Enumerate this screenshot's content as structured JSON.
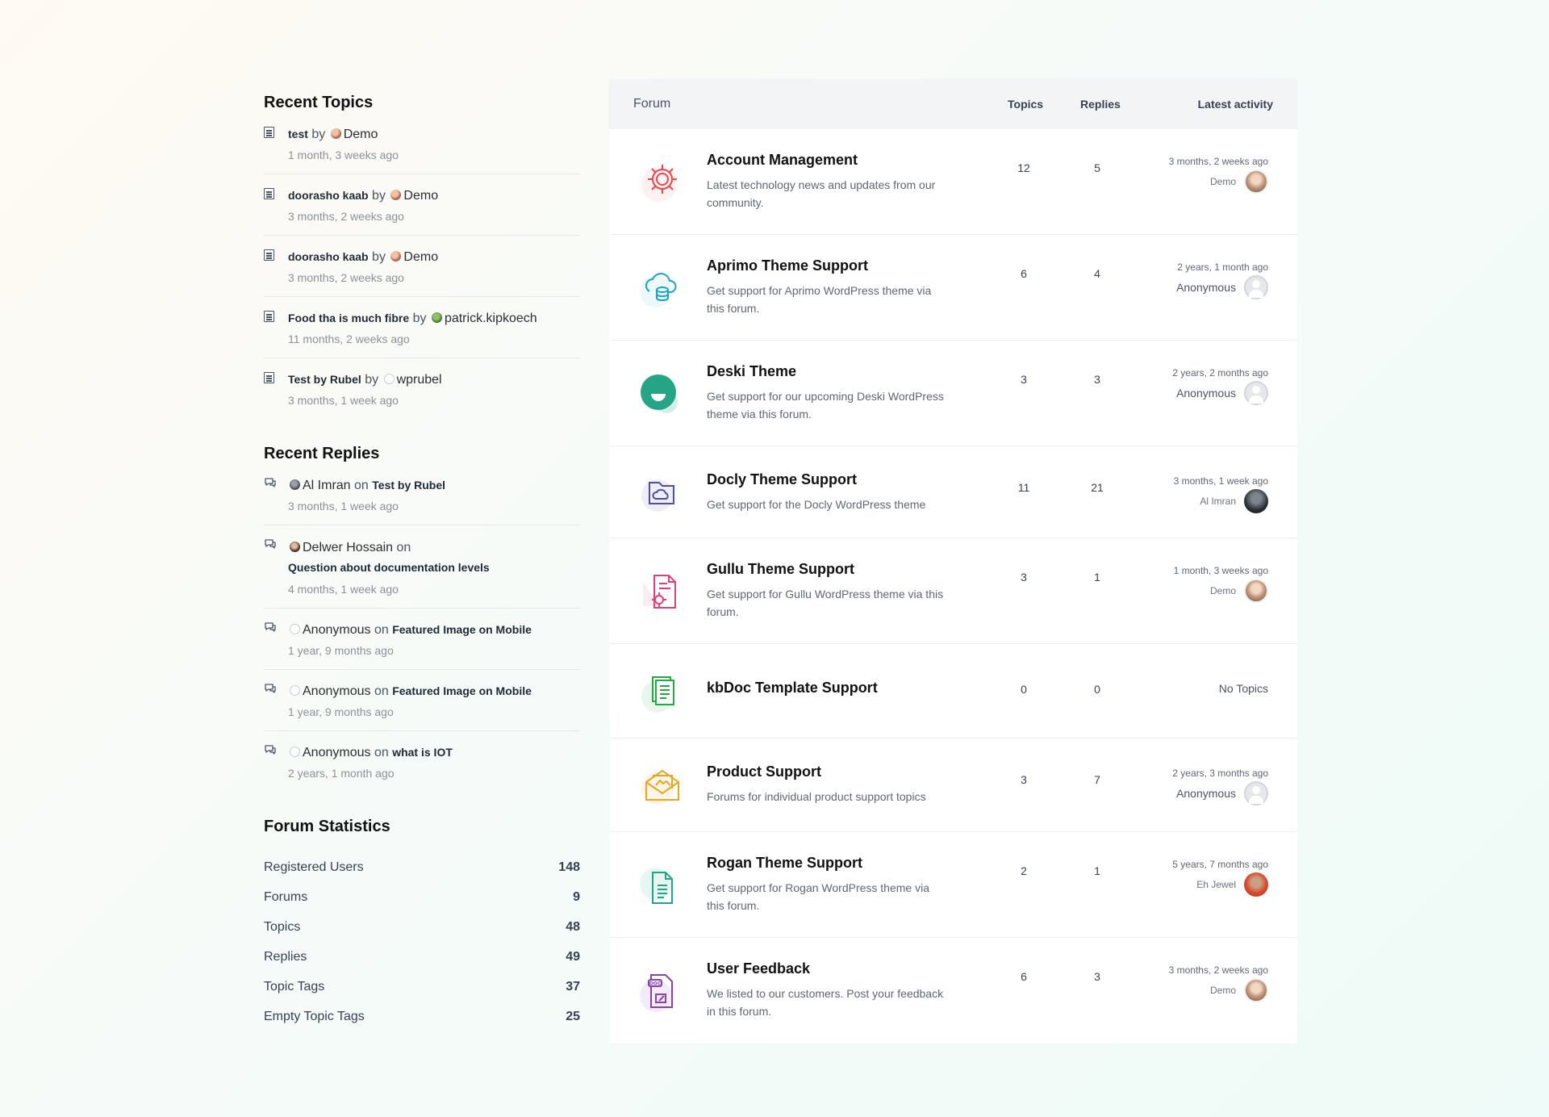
{
  "recent_topics": {
    "title": "Recent Topics",
    "by_word": "by",
    "items": [
      {
        "topic": "test",
        "author": "Demo",
        "avatar": "demo",
        "time": "1 month, 3 weeks ago"
      },
      {
        "topic": "doorasho kaab",
        "author": "Demo",
        "avatar": "demo",
        "time": "3 months, 2 weeks ago"
      },
      {
        "topic": "doorasho kaab",
        "author": "Demo",
        "avatar": "demo",
        "time": "3 months, 2 weeks ago"
      },
      {
        "topic": "Food tha is much fibre",
        "author": "patrick.kipkoech",
        "avatar": "green",
        "time": "11 months, 2 weeks ago"
      },
      {
        "topic": "Test by Rubel",
        "author": "wprubel",
        "avatar": "empty",
        "time": "3 months, 1 week ago"
      }
    ]
  },
  "recent_replies": {
    "title": "Recent Replies",
    "on_word": "on",
    "items": [
      {
        "author": "Al Imran",
        "topic": "Test by Rubel",
        "avatar": "imran",
        "time": "3 months, 1 week ago"
      },
      {
        "author": "Delwer Hossain",
        "topic": "Question about documentation levels",
        "avatar": "delwer",
        "time": "4 months, 1 week ago"
      },
      {
        "author": "Anonymous",
        "topic": "Featured Image on Mobile",
        "avatar": "empty",
        "time": "1 year, 9 months ago"
      },
      {
        "author": "Anonymous",
        "topic": "Featured Image on Mobile",
        "avatar": "empty",
        "time": "1 year, 9 months ago"
      },
      {
        "author": "Anonymous",
        "topic": "what is IOT",
        "avatar": "empty",
        "time": "2 years, 1 month ago"
      }
    ]
  },
  "forum_statistics": {
    "title": "Forum Statistics",
    "items": [
      {
        "label": "Registered Users",
        "value": "148"
      },
      {
        "label": "Forums",
        "value": "9"
      },
      {
        "label": "Topics",
        "value": "48"
      },
      {
        "label": "Replies",
        "value": "49"
      },
      {
        "label": "Topic Tags",
        "value": "37"
      },
      {
        "label": "Empty Topic Tags",
        "value": "25"
      }
    ]
  },
  "forum_table": {
    "headers": {
      "forum": "Forum",
      "topics": "Topics",
      "replies": "Replies",
      "latest": "Latest activity"
    },
    "rows": [
      {
        "title": "Account Management",
        "desc": "Latest technology news and updates from our community.",
        "topics": "12",
        "replies": "5",
        "time": "3 months, 2 weeks ago",
        "author": "Demo",
        "avatar": "demo",
        "icon": "gear-icon",
        "color": "#e8474c"
      },
      {
        "title": "Aprimo Theme Support",
        "desc": "Get support for Aprimo WordPress theme via this forum.",
        "topics": "6",
        "replies": "4",
        "time": "2 years, 1 month ago",
        "author": "Anonymous",
        "avatar": "anon",
        "icon": "cloud-database-icon",
        "color": "#1aa3c9"
      },
      {
        "title": "Deski Theme",
        "desc": "Get support for our upcoming Deski WordPress theme via this forum.",
        "topics": "3",
        "replies": "3",
        "time": "2 years, 2 months ago",
        "author": "Anonymous",
        "avatar": "anon",
        "icon": "deski-logo-icon",
        "color": "#25a586"
      },
      {
        "title": "Docly Theme Support",
        "desc": "Get support for the Docly WordPress theme",
        "topics": "11",
        "replies": "21",
        "time": "3 months, 1 week ago",
        "author": "Al Imran",
        "avatar": "imran",
        "icon": "cloud-folder-icon",
        "color": "#4b4fa8"
      },
      {
        "title": "Gullu Theme Support",
        "desc": "Get support for Gullu WordPress theme via this forum.",
        "topics": "3",
        "replies": "1",
        "time": "1 month, 3 weeks ago",
        "author": "Demo",
        "avatar": "demo",
        "icon": "document-gear-icon",
        "color": "#e0407a"
      },
      {
        "title": "kbDoc Template Support",
        "desc": "",
        "topics": "0",
        "replies": "0",
        "time": "",
        "author": "",
        "avatar": "",
        "no_topics": "No Topics",
        "icon": "documents-icon",
        "color": "#28a745"
      },
      {
        "title": "Product Support",
        "desc": "Forums for individual product support topics",
        "topics": "3",
        "replies": "7",
        "time": "2 years, 3 months ago",
        "author": "Anonymous",
        "avatar": "anon",
        "icon": "envelope-image-icon",
        "color": "#e8a626"
      },
      {
        "title": "Rogan Theme Support",
        "desc": "Get support for Rogan WordPress theme via this forum.",
        "topics": "2",
        "replies": "1",
        "time": "5 years, 7 months ago",
        "author": "Eh Jewel",
        "avatar": "jewel",
        "icon": "document-lines-icon",
        "color": "#21a584"
      },
      {
        "title": "User Feedback",
        "desc": "We listed to our customers. Post your feedback in this forum.",
        "topics": "6",
        "replies": "3",
        "time": "3 months, 2 weeks ago",
        "author": "Demo",
        "avatar": "demo",
        "icon": "doc-file-icon",
        "color": "#8d3fb0"
      }
    ]
  }
}
